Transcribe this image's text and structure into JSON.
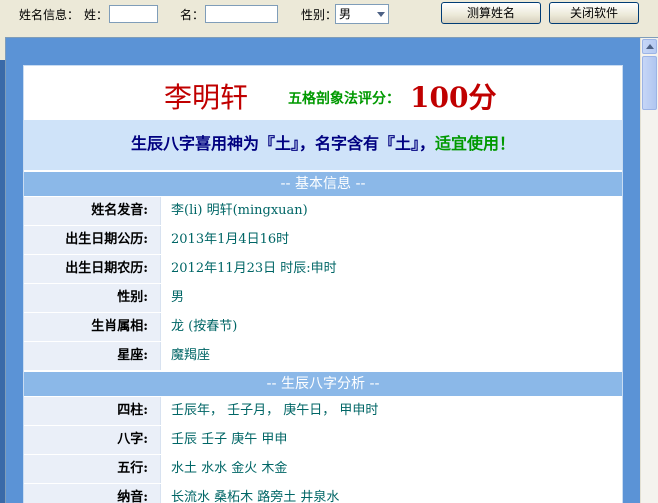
{
  "toolbar": {
    "name_info_label": "姓名信息：",
    "surname_label": "姓：",
    "surname_value": "",
    "given_label": "名：",
    "given_value": "",
    "gender_label": "性别：",
    "gender_value": "男",
    "calc_button": "测算姓名",
    "close_button": "关闭软件"
  },
  "result": {
    "name": "李明轩",
    "score_label": "五格剖象法评分：",
    "score_value": "100分",
    "verdict_main": "生辰八字喜用神为『土』，名字含有『土』，",
    "verdict_good": "适宜使用！"
  },
  "basic": {
    "header": "-- 基本信息 --",
    "rows": [
      {
        "label": "姓名发音:",
        "value": "李(li) 明轩(mingxuan)"
      },
      {
        "label": "出生日期公历:",
        "value": "2013年1月4日16时"
      },
      {
        "label": "出生日期农历:",
        "value": "2012年11月23日 时辰:申时"
      },
      {
        "label": "性别:",
        "value": "男"
      },
      {
        "label": "生肖属相:",
        "value": "龙 (按春节)"
      },
      {
        "label": "星座:",
        "value": "魔羯座"
      }
    ]
  },
  "bazi": {
    "header": "-- 生辰八字分析 --",
    "rows": [
      {
        "label": "四柱:",
        "value": "壬辰年，  壬子月，  庚午日，  甲申时"
      },
      {
        "label": "八字:",
        "value": "壬辰  壬子  庚午  甲申"
      },
      {
        "label": "五行:",
        "value": "水土  水水  金火  木金"
      },
      {
        "label": "纳音:",
        "value": "长流水  桑柘木  路旁土  井泉水"
      }
    ]
  }
}
